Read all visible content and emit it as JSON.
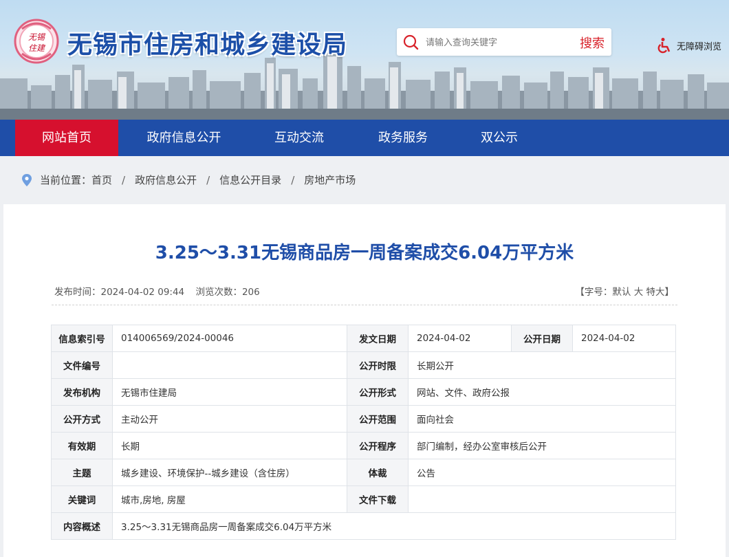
{
  "header": {
    "site_title": "无锡市住房和城乡建设局",
    "logo_text": "无锡住建",
    "search_placeholder": "请输入查询关键字",
    "search_button": "搜索",
    "accessibility": "无障碍浏览"
  },
  "nav": {
    "items": [
      "网站首页",
      "政府信息公开",
      "互动交流",
      "政务服务",
      "双公示"
    ],
    "active_index": 0
  },
  "breadcrumb": {
    "prefix": "当前位置：",
    "items": [
      "首页",
      "政府信息公开",
      "信息公开目录",
      "房地产市场"
    ],
    "separator": "/"
  },
  "article": {
    "title": "3.25～3.31无锡商品房一周备案成交6.04万平方米",
    "publish_time": "发布时间：2024-04-02 09:44",
    "views": "浏览次数：206",
    "font_size_control": "【字号：默认 大 特大】"
  },
  "info_table": {
    "index_label": "信息索引号",
    "index_value": "014006569/2024-00046",
    "issue_date_label": "发文日期",
    "issue_date_value": "2024-04-02",
    "public_date_label": "公开日期",
    "public_date_value": "2024-04-02",
    "doc_no_label": "文件编号",
    "doc_no_value": "",
    "time_limit_label": "公开时限",
    "time_limit_value": "长期公开",
    "agency_label": "发布机构",
    "agency_value": "无锡市住建局",
    "form_label": "公开形式",
    "form_value": "网站、文件、政府公报",
    "mode_label": "公开方式",
    "mode_value": "主动公开",
    "scope_label": "公开范围",
    "scope_value": "面向社会",
    "validity_label": "有效期",
    "validity_value": "长期",
    "procedure_label": "公开程序",
    "procedure_value": "部门编制，经办公室审核后公开",
    "topic_label": "主题",
    "topic_value": "城乡建设、环境保护--城乡建设（含住房）",
    "genre_label": "体裁",
    "genre_value": "公告",
    "keywords_label": "关键词",
    "keywords_value": "城市,房地, 房屋",
    "download_label": "文件下载",
    "download_value": "",
    "summary_label": "内容概述",
    "summary_value": "3.25～3.31无锡商品房一周备案成交6.04万平方米"
  },
  "colors": {
    "brand_blue": "#1f4ea8",
    "active_red": "#d6102e",
    "search_red": "#d8222a"
  }
}
